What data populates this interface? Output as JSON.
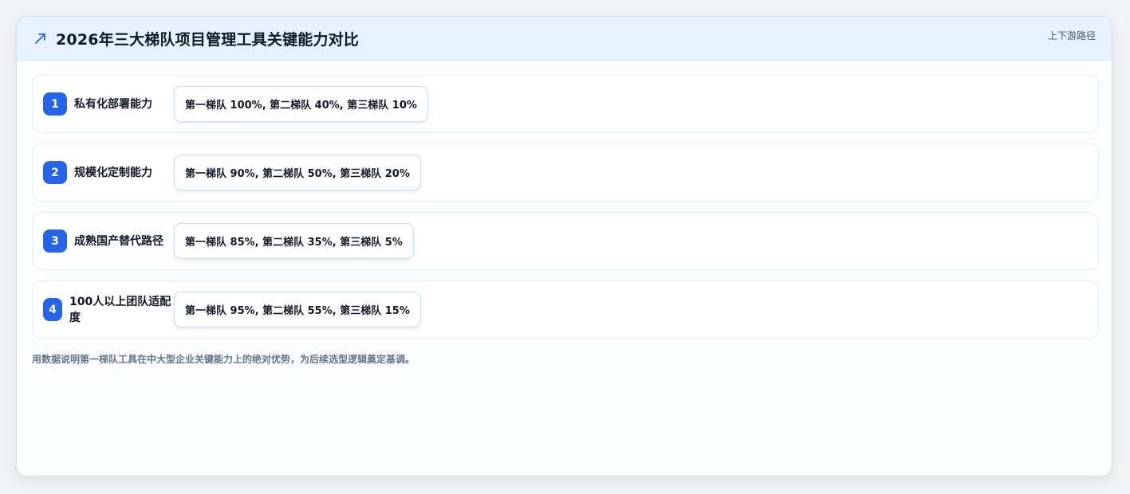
{
  "card": {
    "title": "2026年三大梯队项目管理工具关键能力对比",
    "tag": "上下游路径",
    "icon": "trend-arrow-icon",
    "accent_color": "#2563eb",
    "header_bg": "#e6f2fd",
    "footnote": "用数据说明第一梯队工具在中大型企业关键能力上的绝对优势，为后续选型逻辑奠定基调。"
  },
  "rows": [
    {
      "number": "1",
      "label": "私有化部署能力",
      "values": "第一梯队 100%, 第二梯队 40%, 第三梯队 10%"
    },
    {
      "number": "2",
      "label": "规模化定制能力",
      "values": "第一梯队 90%, 第二梯队 50%, 第三梯队 20%"
    },
    {
      "number": "3",
      "label": "成熟国产替代路径",
      "values": "第一梯队 85%, 第二梯队 35%, 第三梯队 5%"
    },
    {
      "number": "4",
      "label": "100人以上团队适配度",
      "values": "第一梯队 95%, 第二梯队 55%, 第三梯队 15%"
    }
  ]
}
